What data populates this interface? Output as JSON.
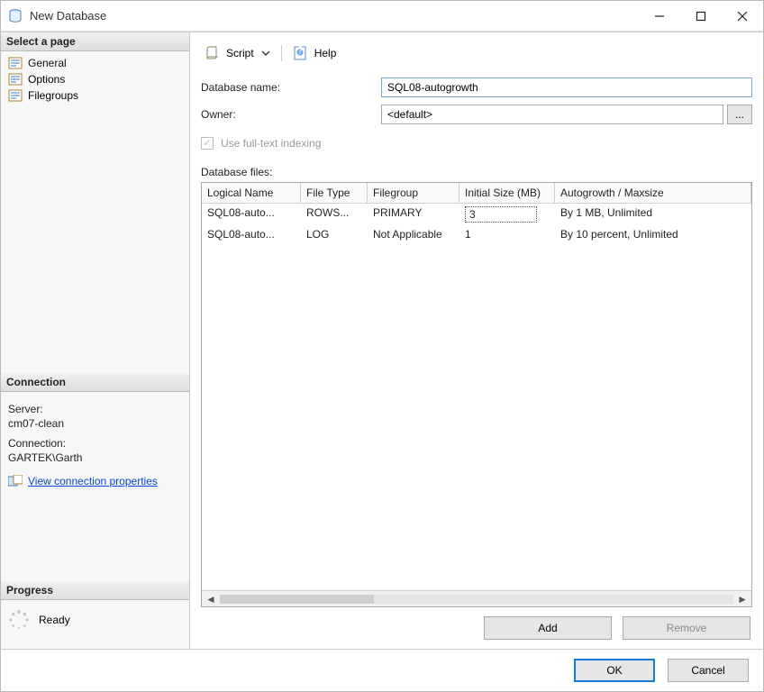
{
  "window": {
    "title": "New Database"
  },
  "sidebar": {
    "heading": "Select a page",
    "pages": [
      {
        "label": "General"
      },
      {
        "label": "Options"
      },
      {
        "label": "Filegroups"
      }
    ],
    "connection_heading": "Connection",
    "server_label": "Server:",
    "server_value": "cm07-clean",
    "connection_label": "Connection:",
    "connection_value": "GARTEK\\Garth",
    "view_props": "View connection properties",
    "progress_heading": "Progress",
    "progress_value": "Ready"
  },
  "toolbar": {
    "script": "Script",
    "help": "Help"
  },
  "form": {
    "db_name_label": "Database name:",
    "db_name_value": "SQL08-autogrowth",
    "owner_label": "Owner:",
    "owner_value": "<default>",
    "fulltext_label": "Use full-text indexing",
    "files_label": "Database files:"
  },
  "grid": {
    "columns": [
      "Logical Name",
      "File Type",
      "Filegroup",
      "Initial Size (MB)",
      "Autogrowth / Maxsize"
    ],
    "rows": [
      {
        "logical": "SQL08-auto...",
        "ftype": "ROWS...",
        "fgroup": "PRIMARY",
        "size": "3",
        "growth": "By 1 MB, Unlimited",
        "editing": true
      },
      {
        "logical": "SQL08-auto...",
        "ftype": "LOG",
        "fgroup": "Not Applicable",
        "size": "1",
        "growth": "By 10 percent, Unlimited",
        "editing": false
      }
    ]
  },
  "actions": {
    "add": "Add",
    "remove": "Remove",
    "ok": "OK",
    "cancel": "Cancel"
  }
}
